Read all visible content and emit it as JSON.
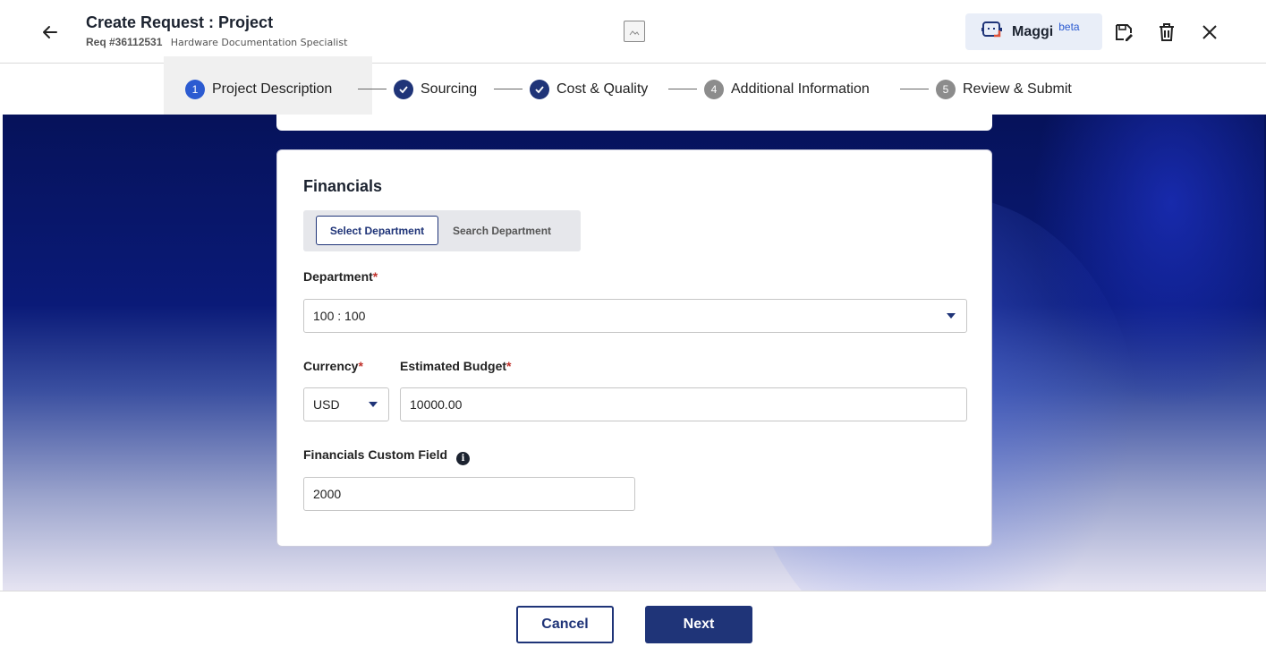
{
  "header": {
    "title": "Create Request :  Project",
    "req_number": "Req #36112531",
    "req_description": "Hardware Documentation Specialist",
    "assistant_name": "Maggi",
    "assistant_badge": "beta"
  },
  "stepper": {
    "steps": [
      {
        "number": "1",
        "label": "Project Description",
        "state": "active"
      },
      {
        "number": "",
        "label": "Sourcing",
        "state": "complete"
      },
      {
        "number": "",
        "label": "Cost & Quality",
        "state": "complete"
      },
      {
        "number": "4",
        "label": "Additional Information",
        "state": "pending"
      },
      {
        "number": "5",
        "label": "Review & Submit",
        "state": "pending"
      }
    ]
  },
  "financials": {
    "section_title": "Financials",
    "toggle_options": [
      "Select  Department",
      "Search  Department"
    ],
    "selected_toggle": "Select  Department",
    "department_label": "Department",
    "department_value": "100 : 100",
    "currency_label": "Currency",
    "currency_value": "USD",
    "budget_label": "Estimated Budget",
    "budget_value": "10000.00",
    "custom_field_label": "Financials Custom Field",
    "custom_field_value": "2000",
    "required_marker": "*",
    "info_glyph": "i"
  },
  "footer": {
    "cancel_label": "Cancel",
    "next_label": "Next"
  },
  "colors": {
    "primary": "#1f3478",
    "accent": "#2c5bd1",
    "required": "#c0312b"
  }
}
